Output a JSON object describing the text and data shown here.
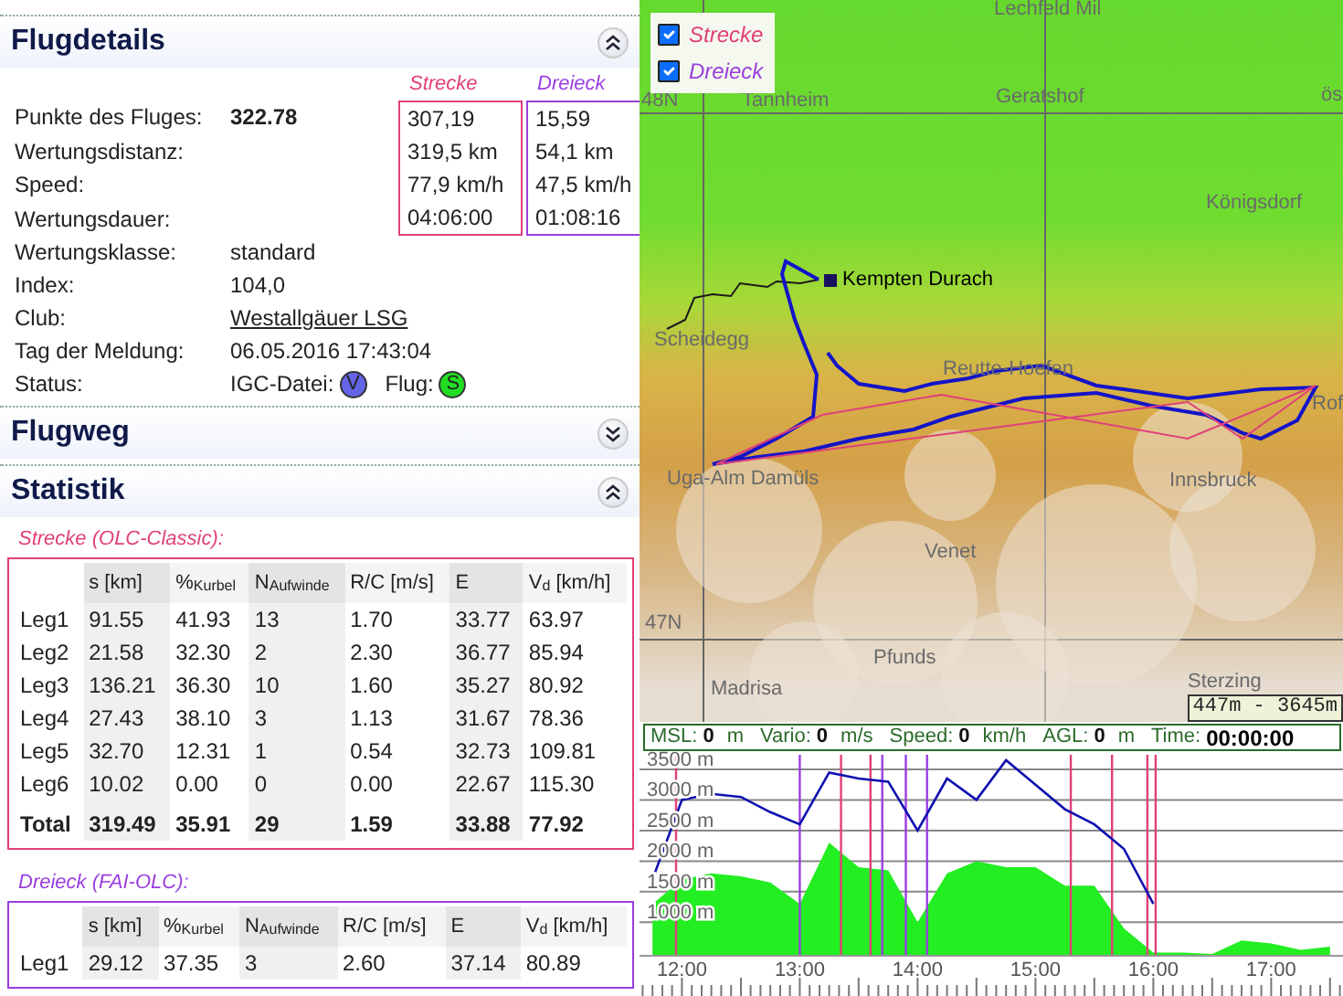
{
  "flugdetails": {
    "title": "Flugdetails",
    "expanded": true,
    "column_headers": [
      {
        "label": "Strecke",
        "color": "#e0407a"
      },
      {
        "label": "Dreieck",
        "color": "#9a3ee0"
      }
    ],
    "rows": [
      {
        "label": "Punkte des Fluges:",
        "value": "322.78",
        "kind": "bold",
        "strecke": "307,19",
        "dreieck": "15,59"
      },
      {
        "label": "Wertungsdistanz:",
        "kind": "plain",
        "strecke": "319,5 km",
        "dreieck": "54,1 km"
      },
      {
        "label": "Speed:",
        "kind": "plain",
        "strecke": "77,9 km/h",
        "dreieck": "47,5 km/h"
      },
      {
        "label": "Wertungsdauer:",
        "kind": "plain",
        "strecke": "04:06:00",
        "dreieck": "01:08:16"
      },
      {
        "label": "Wertungsklasse:",
        "value": "standard",
        "kind": "plain"
      },
      {
        "label": "Index:",
        "value": "104,0",
        "kind": "plain"
      },
      {
        "label": "Club:",
        "value": "Westallgäuer LSG",
        "kind": "link"
      },
      {
        "label": "Tag der Meldung:",
        "value": "06.05.2016 17:43:04",
        "kind": "plain"
      },
      {
        "label": "Status:",
        "kind": "status",
        "items": [
          {
            "label": "IGC-Datei:",
            "badge": "V",
            "color": "#6464e6"
          },
          {
            "label": "Flug:",
            "badge": "S",
            "color": "#22dd22"
          }
        ]
      }
    ]
  },
  "flugweg": {
    "title": "Flugweg",
    "expanded": false
  },
  "statistik": {
    "title": "Statistik",
    "expanded": true,
    "tables": [
      {
        "caption": "Strecke (OLC-Classic):",
        "color": "#e0407a",
        "columns": [
          "s [km]",
          "%$_{Kurbel}$",
          "N$_{Aufwinde}$",
          "R/C [m/s]",
          "E",
          "V$_{d}$ [km/h]"
        ],
        "rows": [
          {
            "label": "Leg1",
            "kind": "leg",
            "cells": [
              "91.55",
              "41.93",
              "13",
              "1.70",
              "33.77",
              "63.97"
            ]
          },
          {
            "label": "Leg2",
            "kind": "leg",
            "cells": [
              "21.58",
              "32.30",
              "2",
              "2.30",
              "36.77",
              "85.94"
            ]
          },
          {
            "label": "Leg3",
            "kind": "leg",
            "cells": [
              "136.21",
              "36.30",
              "10",
              "1.60",
              "35.27",
              "80.92"
            ]
          },
          {
            "label": "Leg4",
            "kind": "leg",
            "cells": [
              "27.43",
              "38.10",
              "3",
              "1.13",
              "31.67",
              "78.36"
            ]
          },
          {
            "label": "Leg5",
            "kind": "leg",
            "cells": [
              "32.70",
              "12.31",
              "1",
              "0.54",
              "32.73",
              "109.81"
            ]
          },
          {
            "label": "Leg6",
            "kind": "leg",
            "cells": [
              "10.02",
              "0.00",
              "0",
              "0.00",
              "22.67",
              "115.30"
            ]
          },
          {
            "label": "Total",
            "kind": "total",
            "cells": [
              "319.49",
              "35.91",
              "29",
              "1.59",
              "33.88",
              "77.92"
            ]
          }
        ]
      },
      {
        "caption": "Dreieck (FAI-OLC):",
        "color": "#9a3ee0",
        "columns": [
          "s [km]",
          "%$_{Kurbel}$",
          "N$_{Aufwinde}$",
          "R/C [m/s]",
          "E",
          "V$_{d}$ [km/h]"
        ],
        "rows": [
          {
            "label": "Leg1",
            "kind": "leg",
            "cells": [
              "29.12",
              "37.35",
              "3",
              "2.60",
              "37.14",
              "80.89"
            ]
          }
        ]
      }
    ]
  },
  "map": {
    "layers": [
      {
        "label": "Strecke",
        "checked": true,
        "color": "#e0407a"
      },
      {
        "label": "Dreieck",
        "checked": true,
        "color": "#9a3ee0"
      }
    ],
    "places": [
      {
        "label": "Lechfeld Mil",
        "kind": "town"
      },
      {
        "label": "48N",
        "kind": "grid"
      },
      {
        "label": "Tannheim",
        "kind": "town"
      },
      {
        "label": "Geratshof",
        "kind": "town"
      },
      {
        "label": "ös",
        "kind": "town"
      },
      {
        "label": "Königsdorf",
        "kind": "town"
      },
      {
        "label": "Kempten Durach",
        "kind": "airfield"
      },
      {
        "label": "Scheidegg",
        "kind": "town"
      },
      {
        "label": "Reutte-Hoefen",
        "kind": "town"
      },
      {
        "label": "Rof",
        "kind": "town"
      },
      {
        "label": "Uga-Alm Damüls",
        "kind": "town"
      },
      {
        "label": "Innsbruck",
        "kind": "town"
      },
      {
        "label": "Venet",
        "kind": "town"
      },
      {
        "label": "47N",
        "kind": "grid"
      },
      {
        "label": "Pfunds",
        "kind": "town"
      },
      {
        "label": "Madrisa",
        "kind": "town"
      },
      {
        "label": "Sterzing",
        "kind": "town"
      }
    ],
    "scale": "447m - 3645m"
  },
  "status_bar": [
    {
      "label": "MSL:",
      "value": "0",
      "unit": "m"
    },
    {
      "label": "Vario:",
      "value": "0",
      "unit": "m/s"
    },
    {
      "label": "Speed:",
      "value": "0",
      "unit": "km/h"
    },
    {
      "label": "AGL:",
      "value": "0",
      "unit": "m"
    },
    {
      "label": "Time:",
      "value": "00:00:00"
    }
  ],
  "barogram": {
    "chart_data": {
      "type": "line",
      "x": [
        11.75,
        12,
        12.25,
        12.5,
        12.75,
        13,
        13.25,
        13.5,
        13.75,
        14,
        14.25,
        14.5,
        14.75,
        15,
        15.25,
        15.5,
        15.75,
        16,
        16.25,
        16.5,
        16.75,
        17,
        17.25,
        17.5
      ],
      "series": [
        {
          "type": "line",
          "color": "#1010b0",
          "values": [
            1700,
            3000,
            3100,
            3050,
            2800,
            2600,
            3450,
            3350,
            3300,
            2500,
            3350,
            3000,
            3650,
            3250,
            2850,
            2600,
            2200,
            1300,
            null,
            null,
            null,
            null,
            null,
            null
          ]
        },
        {
          "type": "area",
          "color": "#22ee22",
          "values": [
            1300,
            1700,
            1800,
            1750,
            1650,
            1300,
            2300,
            1900,
            1850,
            1000,
            1800,
            2000,
            1900,
            1900,
            1600,
            1600,
            900,
            500,
            500,
            480,
            700,
            650,
            550,
            600
          ]
        }
      ],
      "xlim": [
        11.64,
        17.61
      ],
      "ylim": [
        450,
        3800
      ],
      "xticks": [
        {
          "value": 12,
          "label": "12:00"
        },
        {
          "value": 13,
          "label": "13:00"
        },
        {
          "value": 14,
          "label": "14:00"
        },
        {
          "value": 15,
          "label": "15:00"
        },
        {
          "value": 16,
          "label": "16:00"
        },
        {
          "value": 17,
          "label": "17:00"
        }
      ],
      "yticks": [
        {
          "value": 1000,
          "label": "1000 m"
        },
        {
          "value": 1500,
          "label": "1500 m"
        },
        {
          "value": 2000,
          "label": "2000 m"
        },
        {
          "value": 2500,
          "label": "2500 m"
        },
        {
          "value": 3000,
          "label": "3000 m"
        },
        {
          "value": 3500,
          "label": "3500 m"
        }
      ],
      "grid": true,
      "ref_lines": [
        {
          "axis": "x",
          "value": 11.95,
          "color": "#e0407a"
        },
        {
          "axis": "x",
          "value": 13.0,
          "color": "#9a3ee0"
        },
        {
          "axis": "x",
          "value": 13.35,
          "color": "#e0407a"
        },
        {
          "axis": "x",
          "value": 13.6,
          "color": "#e0407a"
        },
        {
          "axis": "x",
          "value": 13.7,
          "color": "#9a3ee0"
        },
        {
          "axis": "x",
          "value": 13.9,
          "color": "#9a3ee0"
        },
        {
          "axis": "x",
          "value": 14.08,
          "color": "#9a3ee0"
        },
        {
          "axis": "x",
          "value": 15.3,
          "color": "#e0407a"
        },
        {
          "axis": "x",
          "value": 15.65,
          "color": "#e0407a"
        },
        {
          "axis": "x",
          "value": 15.95,
          "color": "#e0407a"
        },
        {
          "axis": "x",
          "value": 16.02,
          "color": "#e0407a"
        }
      ]
    }
  }
}
